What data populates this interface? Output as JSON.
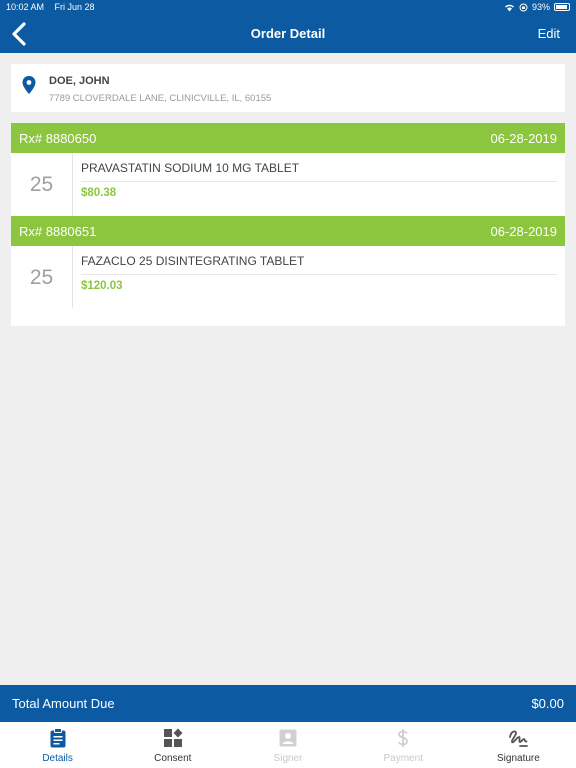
{
  "status": {
    "time": "10:02 AM",
    "date": "Fri Jun 28",
    "battery": "93%"
  },
  "nav": {
    "title": "Order Detail",
    "edit_label": "Edit"
  },
  "patient": {
    "name": "DOE, JOHN",
    "address": "7789 CLOVERDALE LANE, CLINICVILLE, IL, 60155"
  },
  "orders": [
    {
      "rx": "Rx# 8880650",
      "date": "06-28-2019",
      "qty": "25",
      "drug": "PRAVASTATIN SODIUM 10 MG TABLET",
      "price": "$80.38"
    },
    {
      "rx": "Rx# 8880651",
      "date": "06-28-2019",
      "qty": "25",
      "drug": "FAZACLO 25 DISINTEGRATING TABLET",
      "price": "$120.03"
    }
  ],
  "total": {
    "label": "Total Amount Due",
    "amount": "$0.00"
  },
  "tabs": [
    {
      "label": "Details",
      "icon": "clipboard-icon",
      "state": "active"
    },
    {
      "label": "Consent",
      "icon": "grid-icon",
      "state": "normal"
    },
    {
      "label": "Signer",
      "icon": "person-badge-icon",
      "state": "disabled"
    },
    {
      "label": "Payment",
      "icon": "dollar-icon",
      "state": "disabled"
    },
    {
      "label": "Signature",
      "icon": "signature-icon",
      "state": "normal"
    }
  ],
  "colors": {
    "primary": "#0b5aa2",
    "accent_green": "#8cc63f",
    "background": "#efefef"
  }
}
